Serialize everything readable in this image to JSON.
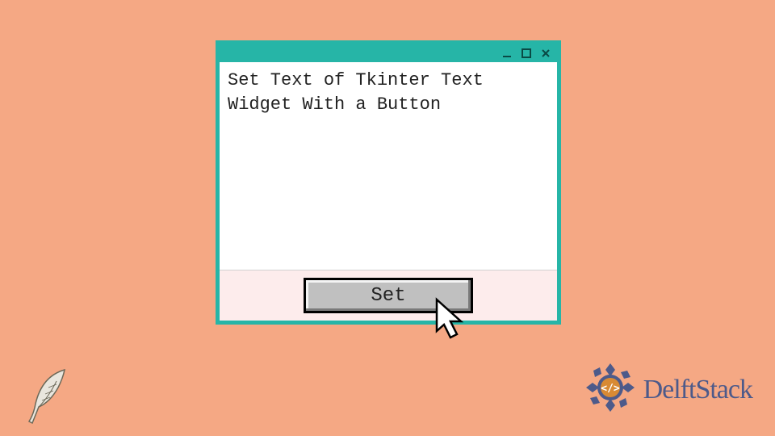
{
  "window": {
    "title": "",
    "text_content": "Set Text of Tkinter Text Widget With a Button",
    "button_label": "Set"
  },
  "branding": {
    "logo_text": "DelftStack"
  },
  "colors": {
    "background": "#f5a884",
    "window_border": "#26b5a7",
    "button_row_bg": "#fdecec",
    "button_bg": "#c0c0c0",
    "logo_blue": "#4d5a8a"
  }
}
